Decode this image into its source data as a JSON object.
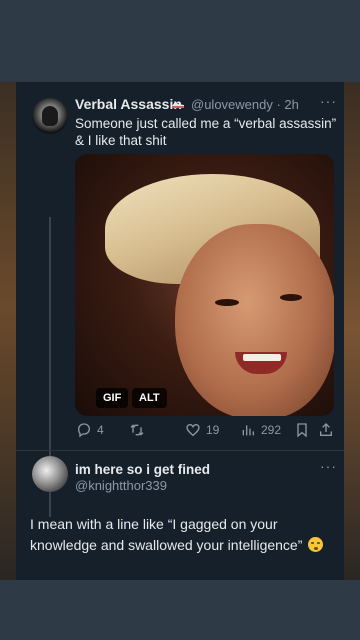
{
  "tweet1": {
    "display_name": "Verbal Assassin",
    "handle_time": "@ulovewendy · 2h",
    "more": "···",
    "text": "Someone just called me a “verbal assassin” & I like that shit",
    "media_badges": {
      "gif": "GIF",
      "alt": "ALT"
    },
    "actions": {
      "replies": "4",
      "retweets": "",
      "likes": "19",
      "views": "292"
    }
  },
  "tweet2": {
    "display_name": "im here so i get fined",
    "handle": "@knightthor339",
    "more": "···",
    "text": "I mean with a line like  “I gagged on your knowledge and swallowed your intelligence”"
  },
  "colors": {
    "background": "#2b3542",
    "card": "#15202b",
    "text_primary": "#e7e9ea",
    "text_secondary": "#8b98a5"
  }
}
